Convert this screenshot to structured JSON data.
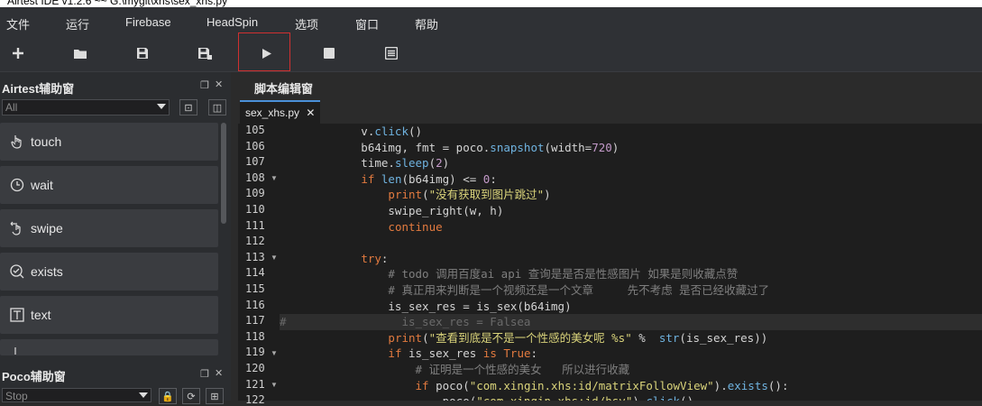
{
  "window": {
    "title": "Airtest IDE v1.2.6 ~~ G:\\mygit\\xhs\\sex_xhs.py"
  },
  "menu": [
    "文件",
    "运行",
    "Firebase",
    "HeadSpin",
    "选项",
    "窗口",
    "帮助"
  ],
  "toolbar": {
    "icons": [
      "new-file-icon",
      "open-folder-icon",
      "save-icon",
      "save-as-icon",
      "run-icon",
      "stop-icon",
      "log-icon"
    ]
  },
  "airtest_panel": {
    "title": "Airtest辅助窗",
    "filter_value": "All",
    "buttons": [
      "touch",
      "wait",
      "swipe",
      "exists",
      "text"
    ]
  },
  "poco_panel": {
    "title": "Poco辅助窗",
    "mode_value": "Stop"
  },
  "editor": {
    "title": "脚本编辑窗",
    "tab_label": "sex_xhs.py",
    "tab_close": "✕",
    "line_numbers": [
      "105",
      "106",
      "107",
      "108",
      "109",
      "110",
      "111",
      "112",
      "113",
      "114",
      "115",
      "116",
      "117",
      "118",
      "119",
      "120",
      "121",
      "122"
    ]
  }
}
